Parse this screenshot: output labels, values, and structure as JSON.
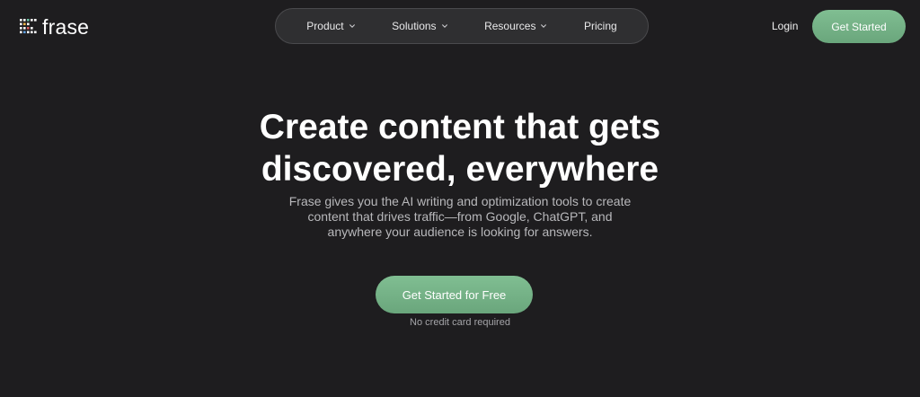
{
  "brand": {
    "name": "frase",
    "accent_color": "#77b487",
    "logo_icon": "frase-logo-icon"
  },
  "nav": {
    "items": [
      {
        "label": "Product",
        "has_dropdown": true
      },
      {
        "label": "Solutions",
        "has_dropdown": true
      },
      {
        "label": "Resources",
        "has_dropdown": true
      },
      {
        "label": "Pricing",
        "has_dropdown": false
      }
    ],
    "dropdown_icon": "chevron-down-icon"
  },
  "header": {
    "login_label": "Login",
    "cta_label": "Get Started"
  },
  "hero": {
    "title_line1": "Create content that gets",
    "title_line2": "discovered, everywhere",
    "subtitle_line1": "Frase gives you the AI writing and optimization tools to create",
    "subtitle_line2": "content that drives traffic—from Google, ChatGPT, and",
    "subtitle_line3": "anywhere your audience is looking for answers.",
    "cta_label": "Get Started for Free",
    "note": "No credit card required"
  },
  "colors": {
    "background": "#1e1d1f",
    "button": "#77b487",
    "nav_pill": "#2f2f31"
  }
}
